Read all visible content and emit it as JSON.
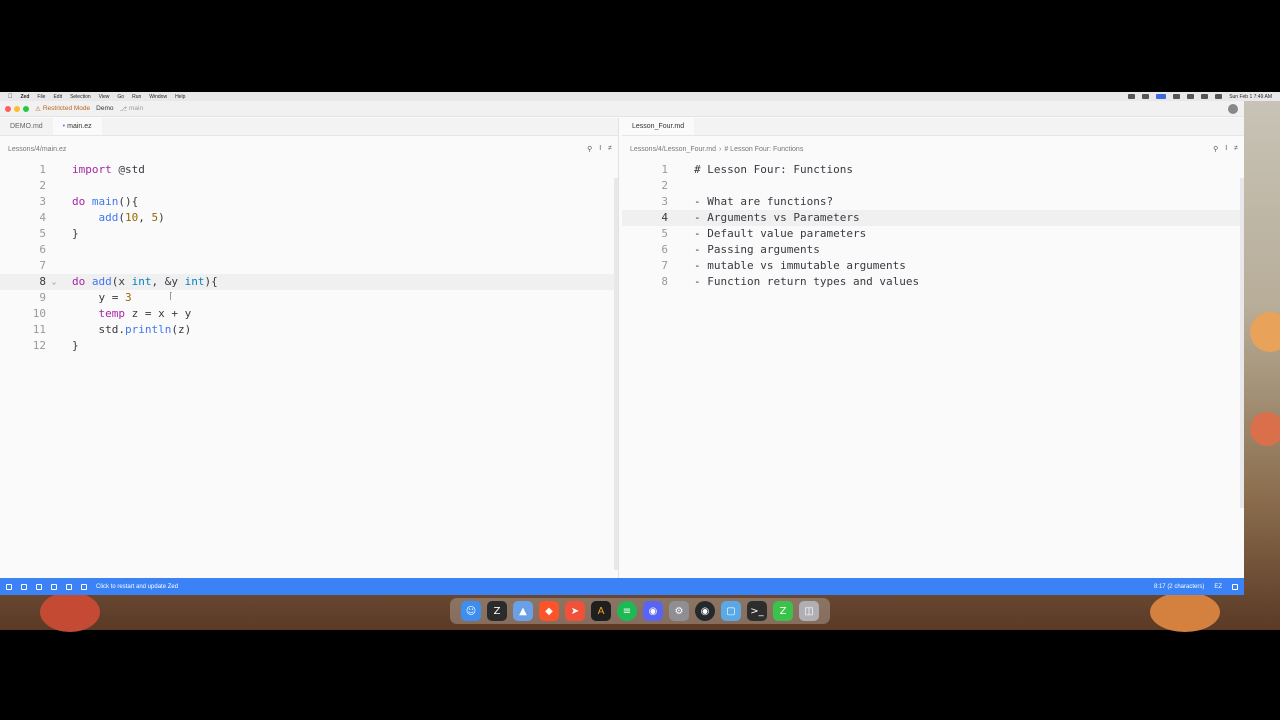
{
  "menubar": {
    "app": "Zed",
    "items": [
      "File",
      "Edit",
      "Selection",
      "View",
      "Go",
      "Run",
      "Window",
      "Help"
    ],
    "clock": "Sun Feb 1 7:49 AM"
  },
  "titlebar": {
    "restricted": "Restricted Mode",
    "project": "Demo",
    "branch": "main"
  },
  "left_pane": {
    "tabs": [
      {
        "label": "DEMO.md",
        "active": false,
        "modified": false
      },
      {
        "label": "main.ez",
        "active": true,
        "modified": true
      }
    ],
    "breadcrumb": "Lessons/4/main.ez",
    "lines": [
      {
        "n": "1",
        "text": "import @std"
      },
      {
        "n": "2",
        "text": ""
      },
      {
        "n": "3",
        "text": "do main(){"
      },
      {
        "n": "4",
        "text": "    add(10, 5)"
      },
      {
        "n": "5",
        "text": "}"
      },
      {
        "n": "6",
        "text": ""
      },
      {
        "n": "7",
        "text": ""
      },
      {
        "n": "8",
        "text": "do add(x int, &y int){"
      },
      {
        "n": "9",
        "text": "    y = 3"
      },
      {
        "n": "10",
        "text": "    temp z = x + y"
      },
      {
        "n": "11",
        "text": "    std.println(z)"
      },
      {
        "n": "12",
        "text": "}"
      }
    ]
  },
  "right_pane": {
    "tabs": [
      {
        "label": "Lesson_Four.md",
        "active": true
      }
    ],
    "breadcrumb_path": "Lessons/4/Lesson_Four.md",
    "breadcrumb_symbol": "# Lesson Four: Functions",
    "lines": [
      {
        "n": "1",
        "text": "# Lesson Four: Functions"
      },
      {
        "n": "2",
        "text": ""
      },
      {
        "n": "3",
        "text": "- What are functions?"
      },
      {
        "n": "4",
        "text": "- Arguments vs Parameters"
      },
      {
        "n": "5",
        "text": "- Default value parameters"
      },
      {
        "n": "6",
        "text": "- Passing arguments"
      },
      {
        "n": "7",
        "text": "- mutable vs immutable arguments"
      },
      {
        "n": "8",
        "text": "- Function return types and values"
      }
    ],
    "current_line": "4"
  },
  "statusbar": {
    "message": "Click to restart and update Zed",
    "position": "8:17 (2 characters)",
    "language": "EZ"
  },
  "dock": {
    "icons": [
      "finder-icon",
      "zed-icon",
      "affinity-icon",
      "brave-icon",
      "swift-icon",
      "arc-icon",
      "spotify-icon",
      "discord-icon",
      "settings-icon",
      "github-icon",
      "folder-icon",
      "terminal-icon",
      "zed-preview-icon",
      "trash-icon"
    ]
  },
  "colors": {
    "accent": "#3b82f6",
    "keyword": "#a626a4",
    "function": "#4078f2",
    "number": "#986801",
    "type": "#0184bc"
  }
}
